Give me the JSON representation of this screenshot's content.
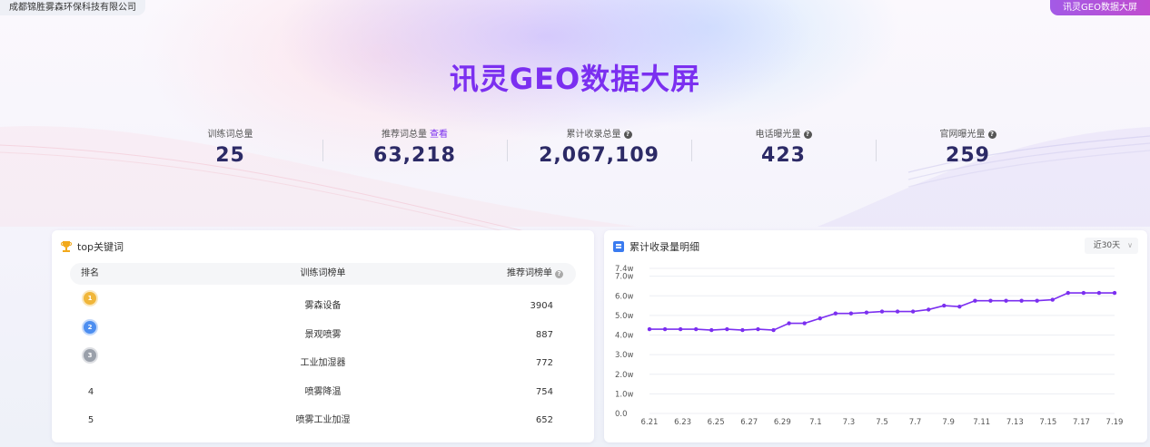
{
  "header": {
    "company": "成都锦胜雾森环保科技有限公司",
    "badge": "讯灵GEO数据大屏",
    "title": "讯灵GEO数据大屏"
  },
  "stats": [
    {
      "label": "训练词总量",
      "value": "25",
      "link": "",
      "help": false
    },
    {
      "label": "推荐词总量",
      "value": "63,218",
      "link": "查看",
      "help": false
    },
    {
      "label": "累计收录总量",
      "value": "2,067,109",
      "link": "",
      "help": true
    },
    {
      "label": "电话曝光量",
      "value": "423",
      "link": "",
      "help": true
    },
    {
      "label": "官网曝光量",
      "value": "259",
      "link": "",
      "help": true
    }
  ],
  "keywords": {
    "title": "top关键词",
    "columns": {
      "rank": "排名",
      "train": "训练词榜单",
      "rec": "推荐词榜单"
    },
    "rows": [
      {
        "rank": "1",
        "keyword": "雾森设备",
        "value": "3904",
        "medal": "gold"
      },
      {
        "rank": "2",
        "keyword": "景观喷雾",
        "value": "887",
        "medal": "blue"
      },
      {
        "rank": "3",
        "keyword": "工业加湿器",
        "value": "772",
        "medal": "silver"
      },
      {
        "rank": "4",
        "keyword": "喷雾降温",
        "value": "754",
        "medal": ""
      },
      {
        "rank": "5",
        "keyword": "喷雾工业加湿",
        "value": "652",
        "medal": ""
      }
    ],
    "medal_colors": {
      "gold": "#f0b63a",
      "blue": "#4d8ef0",
      "silver": "#9aa0aa"
    }
  },
  "trend": {
    "title": "累计收录量明细",
    "range_label": "近30天"
  },
  "chart_data": {
    "type": "line",
    "title": "累计收录量明细",
    "x": [
      "6.21",
      "6.22",
      "6.23",
      "6.24",
      "6.25",
      "6.26",
      "6.27",
      "6.28",
      "6.29",
      "6.30",
      "7.1",
      "7.2",
      "7.3",
      "7.4",
      "7.5",
      "7.6",
      "7.7",
      "7.8",
      "7.9",
      "7.10",
      "7.11",
      "7.12",
      "7.13",
      "7.14",
      "7.15",
      "7.16",
      "7.17",
      "7.18",
      "7.19"
    ],
    "x_tick_labels": [
      "6.21",
      "6.23",
      "6.25",
      "6.27",
      "6.29",
      "7.1",
      "7.3",
      "7.5",
      "7.7",
      "7.9",
      "7.11",
      "7.13",
      "7.15",
      "7.17",
      "7.19"
    ],
    "y_tick_labels": [
      "0.0",
      "1.0w",
      "2.0w",
      "3.0w",
      "4.0w",
      "5.0w",
      "6.0w",
      "7.0w",
      "7.4w"
    ],
    "y_ticks": [
      0,
      1,
      2,
      3,
      4,
      5,
      6,
      7,
      7.4
    ],
    "ylim": [
      0,
      7.4
    ],
    "y_unit": "w",
    "series": [
      {
        "values": [
          4.3,
          4.3,
          4.3,
          4.3,
          4.25,
          4.3,
          4.25,
          4.3,
          4.25,
          4.6,
          4.6,
          4.85,
          5.1,
          5.1,
          5.15,
          5.2,
          5.2,
          5.2,
          5.3,
          5.5,
          5.45,
          5.75,
          5.75,
          5.75,
          5.75,
          5.75,
          5.8,
          6.15,
          6.15,
          6.15,
          6.15
        ]
      }
    ],
    "line_color": "#7b2ff0",
    "grid": true
  }
}
